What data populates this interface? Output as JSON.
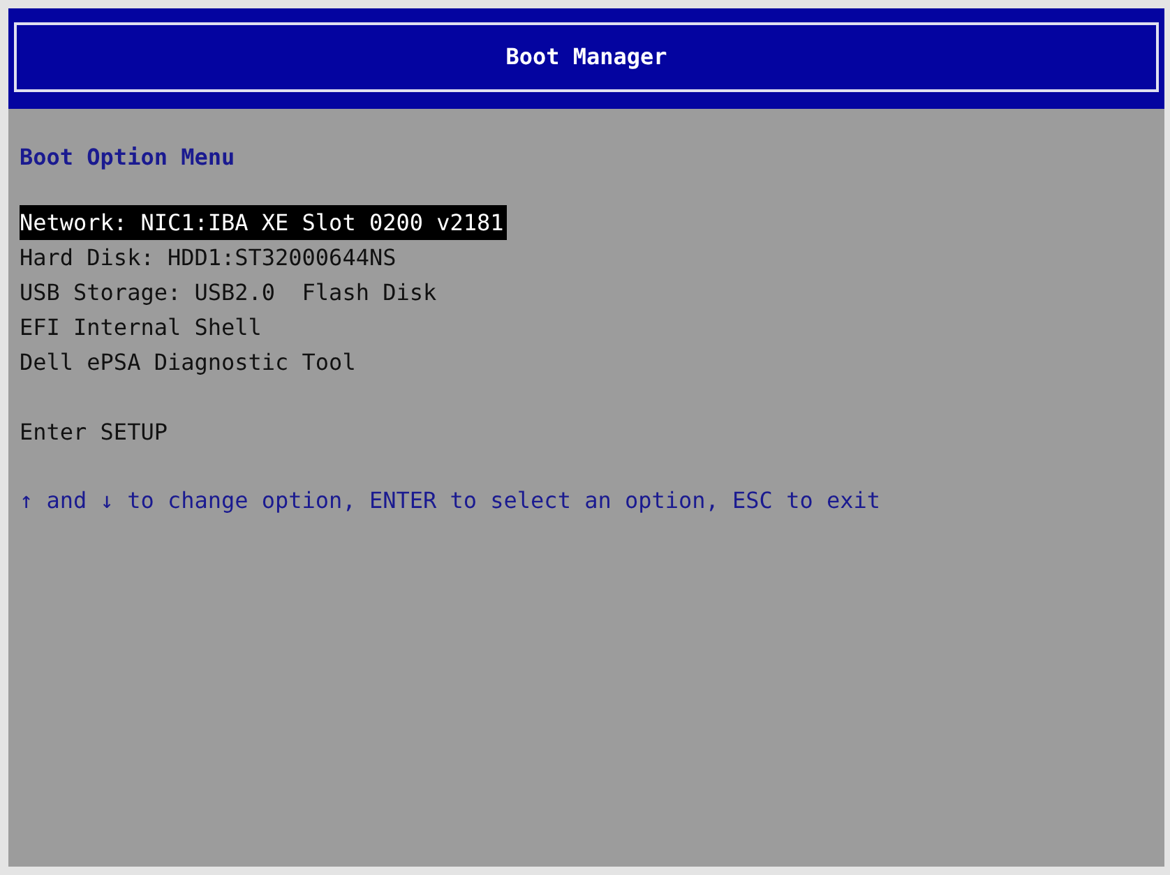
{
  "header": {
    "title": "Boot Manager"
  },
  "menu": {
    "title": "Boot Option Menu",
    "options": [
      {
        "label": "Network: NIC1:IBA XE Slot 0200 v2181",
        "selected": true
      },
      {
        "label": "Hard Disk: HDD1:ST32000644NS",
        "selected": false
      },
      {
        "label": "USB Storage: USB2.0  Flash Disk",
        "selected": false
      },
      {
        "label": "EFI Internal Shell",
        "selected": false
      },
      {
        "label": "Dell ePSA Diagnostic Tool",
        "selected": false
      }
    ],
    "setup": {
      "label": "Enter SETUP",
      "selected": false
    }
  },
  "help": "↑ and ↓ to change option, ENTER to select an option, ESC to exit"
}
